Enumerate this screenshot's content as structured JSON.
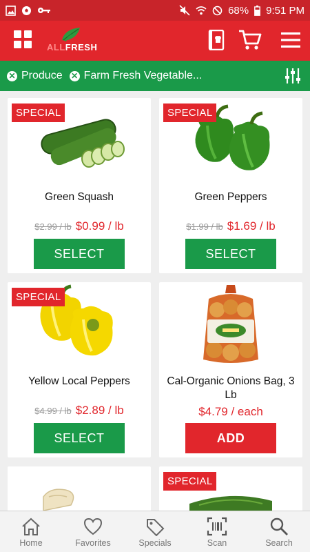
{
  "status_bar": {
    "battery": "68%",
    "time": "9:51 PM"
  },
  "header": {
    "logo_text_pre": "ALL",
    "logo_text": "FRESH"
  },
  "filters": {
    "chips": [
      {
        "label": "Produce"
      },
      {
        "label": "Farm Fresh Vegetable..."
      }
    ]
  },
  "products": [
    {
      "badge": "SPECIAL",
      "name": "Green Squash",
      "old_price": "$2.99 / lb",
      "price": "$0.99 / lb",
      "button": "SELECT"
    },
    {
      "badge": "SPECIAL",
      "name": "Green Peppers",
      "old_price": "$1.99 / lb",
      "price": "$1.69 / lb",
      "button": "SELECT"
    },
    {
      "badge": "SPECIAL",
      "name": "Yellow Local Peppers",
      "old_price": "$4.99 / lb",
      "price": "$2.89 / lb",
      "button": "SELECT"
    },
    {
      "badge": "",
      "name": "Cal-Organic Onions Bag, 3 Lb",
      "old_price": "",
      "price": "$4.79 / each",
      "button": "ADD"
    },
    {
      "badge": "",
      "name": "",
      "old_price": "",
      "price": "",
      "button": ""
    },
    {
      "badge": "SPECIAL",
      "name": "",
      "old_price": "",
      "price": "",
      "button": ""
    }
  ],
  "bottom_nav": [
    {
      "label": "Home",
      "icon": "home-icon"
    },
    {
      "label": "Favorites",
      "icon": "heart-icon"
    },
    {
      "label": "Specials",
      "icon": "tag-icon"
    },
    {
      "label": "Scan",
      "icon": "barcode-icon"
    },
    {
      "label": "Search",
      "icon": "search-icon"
    }
  ],
  "colors": {
    "brand_red": "#e1262c",
    "brand_green": "#1a9a49"
  }
}
